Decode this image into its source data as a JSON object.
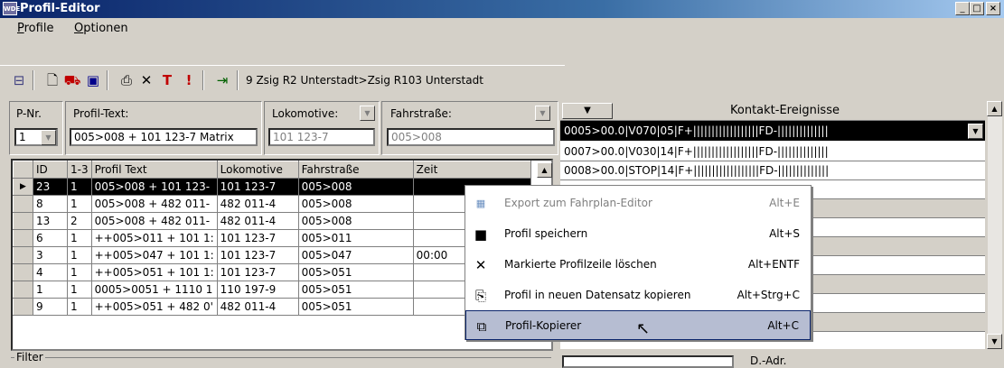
{
  "window": {
    "title": "Profil-Editor",
    "app_icon_text": "WDE"
  },
  "menu": [
    {
      "label": "Profile",
      "accel": "P",
      "rest": "rofile"
    },
    {
      "label": "Optionen",
      "accel": "O",
      "rest": "ptionen"
    }
  ],
  "toolbar": {
    "route_text": "9 Zsig R2 Unterstadt>Zsig R103 Unterstadt"
  },
  "form": {
    "pnr_label": "P-Nr.",
    "pnr_value": "1",
    "profiltext_label": "Profil-Text:",
    "profiltext_value": "005>008 + 101 123-7 Matrix",
    "lok_label": "Lokomotive:",
    "lok_value": "101 123-7",
    "fahr_label": "Fahrstraße:",
    "fahr_value": "005>008",
    "filter_label": "Filter",
    "dadr_label": "D.-Adr."
  },
  "grid": {
    "columns": [
      "ID",
      "1-3",
      "Profil Text",
      "Lokomotive",
      "Fahrstraße",
      "Zeit"
    ],
    "rows": [
      [
        "23",
        "1",
        "005>008 + 101 123-",
        "101 123-7",
        "005>008",
        ""
      ],
      [
        "8",
        "1",
        "005>008 + 482 011-",
        "482 011-4",
        "005>008",
        ""
      ],
      [
        "13",
        "2",
        "005>008 + 482 011-",
        "482 011-4",
        "005>008",
        ""
      ],
      [
        "6",
        "1",
        "++005>011 + 101 1:",
        "101 123-7",
        "005>011",
        ""
      ],
      [
        "3",
        "1",
        "++005>047 + 101 1:",
        "101 123-7",
        "005>047",
        "00:00"
      ],
      [
        "4",
        "1",
        "++005>051 + 101 1:",
        "101 123-7",
        "005>051",
        ""
      ],
      [
        "1",
        "1",
        "0005>0051 + 1110 1",
        "110 197-9",
        "005>051",
        ""
      ],
      [
        "9",
        "1",
        "++005>051 + 482 0'",
        "482 011-4",
        "005>051",
        ""
      ]
    ]
  },
  "events": {
    "header": "Kontakt-Ereignisse",
    "selected": "0005>00.0|V070|05|F+||||||||||||||||||FD-||||||||||||||",
    "rows": [
      "0007>00.0|V030|14|F+||||||||||||||||||FD-||||||||||||||",
      "0008>00.0|STOP|14|F+||||||||||||||||||FD-||||||||||||||"
    ]
  },
  "context_menu": [
    {
      "label": "Export zum Fahrplan-Editor",
      "shortcut": "Alt+E",
      "icon": "export-icon",
      "disabled": true
    },
    {
      "label": "Profil speichern",
      "shortcut": "Alt+S",
      "icon": "save-icon",
      "disabled": false
    },
    {
      "label": "Markierte Profilzeile löschen",
      "shortcut": "Alt+ENTF",
      "icon": "delete-icon",
      "disabled": false
    },
    {
      "label": "Profil in neuen Datensatz kopieren",
      "shortcut": "Alt+Strg+C",
      "icon": "copy-icon",
      "disabled": false
    },
    {
      "label": "Profil-Kopierer",
      "shortcut": "Alt+C",
      "icon": "copier-icon",
      "disabled": false,
      "highlighted": true
    }
  ]
}
